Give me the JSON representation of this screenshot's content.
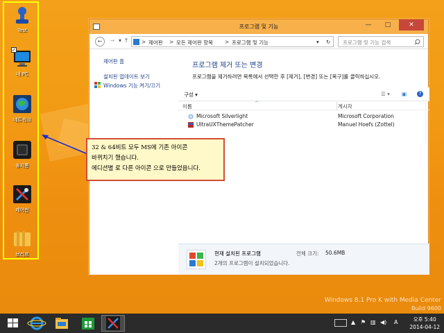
{
  "desktop": {
    "icons": [
      {
        "label": "Test",
        "icon": "user-stamp-icon"
      },
      {
        "label": "내 PC",
        "icon": "monitor-icon"
      },
      {
        "label": "네트워크",
        "icon": "network-globe-icon"
      },
      {
        "label": "휴지통",
        "icon": "recycle-bin-icon"
      },
      {
        "label": "제어판",
        "icon": "control-panel-icon"
      },
      {
        "label": "브리프",
        "icon": "folder-icon"
      }
    ]
  },
  "window": {
    "title": "프로그램 및 기능",
    "minimize": "—",
    "maximize": "□",
    "close": "✕",
    "nav": {
      "back": "←",
      "forward": "→",
      "history": "▾",
      "up": "↑",
      "refresh": "↻"
    },
    "address": {
      "crumbs": [
        "제어판",
        "모든 제어판 항목",
        "프로그램 및 기능"
      ],
      "separator": ">"
    },
    "search_placeholder": "프로그램 및 기능 검색",
    "left_pane": {
      "home": "제어판 홈",
      "updates": "설치된 업데이트 보기",
      "features": "Windows 기능 켜기/끄기"
    },
    "heading": "프로그램 제거 또는 변경",
    "description": "프로그램을 제거하려면 목록에서 선택한 후 [제거], [변경] 또는 [복구]를 클릭하십시오.",
    "toolbar": {
      "organize": "구성 ▾"
    },
    "columns": {
      "name": "이름",
      "publisher": "게시자"
    },
    "programs": [
      {
        "name": "Microsoft Silverlight",
        "publisher": "Microsoft Corporation"
      },
      {
        "name": "UltraUXThemePatcher",
        "publisher": "Manuel Hoefs (Zottel)"
      }
    ],
    "details": {
      "title": "현재 설치된 프로그램",
      "size_label": "전체 크기:",
      "size_value": "50.6MB",
      "count_text": "2개의 프로그램이 설치되었습니다."
    }
  },
  "callout": {
    "line1": "32 & 64비트 모두 MS에 기존 아이콘",
    "line2": "바뀌치기 했습니다.",
    "line3": "에디션별 로 다른 아이콘 으로 만들었읍니다."
  },
  "watermark": {
    "edition": "Windows 8.1 Pro K with Media Center",
    "build": "Build 9600"
  },
  "taskbar": {
    "apps": [
      "windows-start-icon",
      "internet-explorer-icon",
      "file-explorer-icon",
      "store-icon",
      "control-panel-icon"
    ],
    "tray_lang": "A",
    "time": "오후 5:40",
    "date": "2014-04-12"
  },
  "colors": {
    "desktop": "#f29a14",
    "titlebar": "#f7b04a",
    "link": "#1e3f8a",
    "callout_border": "#d24a36",
    "highlight_border": "#ffff00",
    "taskbar": "#2b2b2b"
  }
}
